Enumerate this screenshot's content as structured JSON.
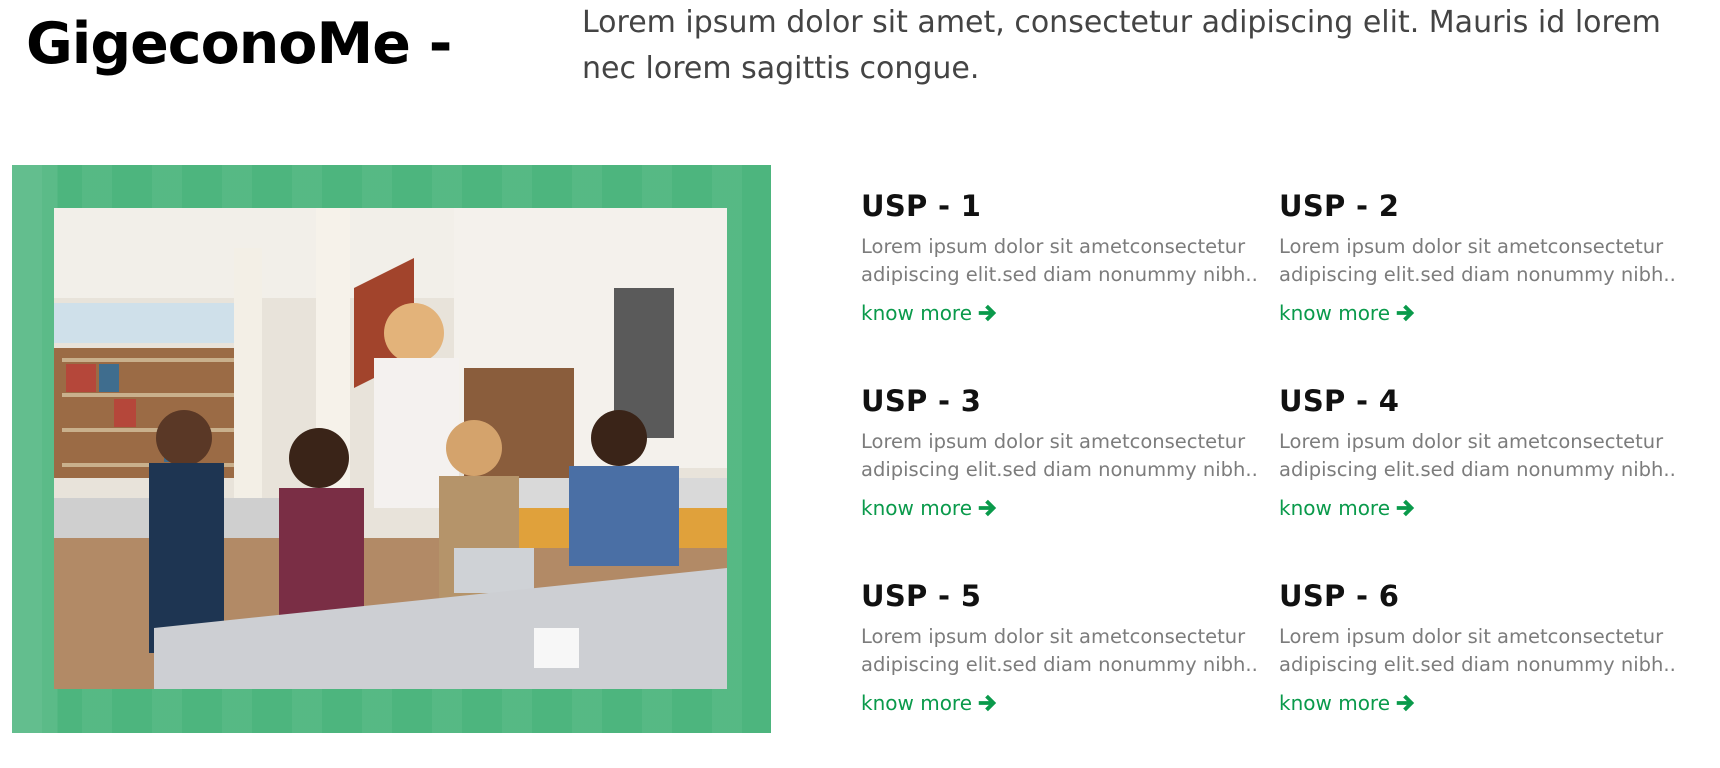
{
  "header": {
    "brand_title": "GigeconoMe -",
    "intro_text": "Lorem ipsum dolor sit amet, consectetur adipiscing elit. Mauris id lorem nec lorem sagittis congue."
  },
  "colors": {
    "accent_green": "#0a9a4b",
    "frame_green": "#4db57e",
    "heading": "#111111",
    "body_text": "#7c7c7c"
  },
  "hero_image": {
    "icon": "group-photo"
  },
  "usps": [
    {
      "title": "USP - 1",
      "description": "Lorem ipsum dolor sit ametconsectetur adipiscing elit.sed diam nonummy nibh..",
      "link_label": "know more",
      "link_icon": "arrow-right-icon"
    },
    {
      "title": "USP - 2",
      "description": "Lorem ipsum dolor sit ametconsectetur adipiscing elit.sed diam nonummy nibh..",
      "link_label": "know more",
      "link_icon": "arrow-right-icon"
    },
    {
      "title": "USP - 3",
      "description": "Lorem ipsum dolor sit ametconsectetur adipiscing elit.sed diam nonummy nibh..",
      "link_label": "know more",
      "link_icon": "arrow-right-icon"
    },
    {
      "title": "USP - 4",
      "description": "Lorem ipsum dolor sit ametconsectetur adipiscing elit.sed diam nonummy nibh..",
      "link_label": "know more",
      "link_icon": "arrow-right-icon"
    },
    {
      "title": "USP - 5",
      "description": "Lorem ipsum dolor sit ametconsectetur adipiscing elit.sed diam nonummy nibh..",
      "link_label": "know more",
      "link_icon": "arrow-right-icon"
    },
    {
      "title": "USP - 6",
      "description": "Lorem ipsum dolor sit ametconsectetur adipiscing elit.sed diam nonummy nibh..",
      "link_label": "know more",
      "link_icon": "arrow-right-icon"
    }
  ]
}
